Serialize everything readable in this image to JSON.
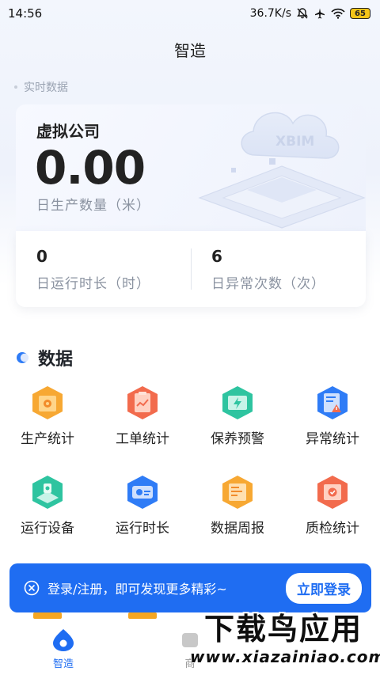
{
  "status_bar": {
    "time": "14:56",
    "speed": "36.7K/s",
    "battery": "65"
  },
  "header": {
    "title": "智造"
  },
  "realtime": {
    "label": "实时数据"
  },
  "hero": {
    "company": "虚拟公司",
    "value": "0.00",
    "value_label": "日生产数量（米）",
    "illustration_text": "XBIM"
  },
  "stats": [
    {
      "value": "0",
      "label": "日运行时长（时）"
    },
    {
      "value": "6",
      "label": "日异常次数（次）"
    }
  ],
  "data_section": {
    "title": "数据",
    "items": [
      {
        "label": "生产统计",
        "icon": "production-stats-icon",
        "color": "#f5a623"
      },
      {
        "label": "工单统计",
        "icon": "work-order-icon",
        "color": "#f06a4f"
      },
      {
        "label": "保养预警",
        "icon": "maintenance-alert-icon",
        "color": "#2ec4a0"
      },
      {
        "label": "异常统计",
        "icon": "exception-stats-icon",
        "color": "#2f7cf6"
      },
      {
        "label": "运行设备",
        "icon": "running-equipment-icon",
        "color": "#2ec4a0"
      },
      {
        "label": "运行时长",
        "icon": "run-time-icon",
        "color": "#2f7cf6"
      },
      {
        "label": "数据周报",
        "icon": "weekly-report-icon",
        "color": "#f5a623"
      },
      {
        "label": "质检统计",
        "icon": "quality-check-icon",
        "color": "#f06a4f"
      }
    ]
  },
  "login_bar": {
    "text": "登录/注册，即可发现更多精彩~",
    "button": "立即登录",
    "color": "#1f6df2"
  },
  "tabbar": {
    "tabs": [
      {
        "label": "智造",
        "active": true
      },
      {
        "label": "商"
      }
    ]
  },
  "watermark": {
    "cn": "下载鸟应用",
    "en": "www.xiazainiao.com"
  }
}
